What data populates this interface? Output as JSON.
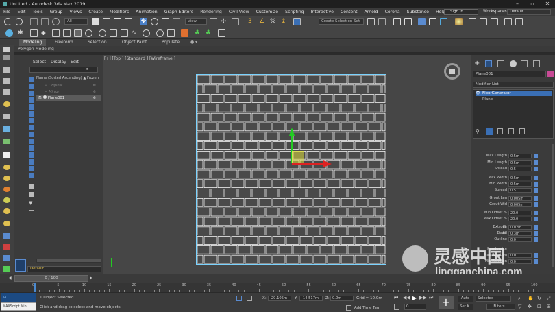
{
  "window": {
    "title": "Untitled - Autodesk 3ds Max 2019"
  },
  "menu": [
    "File",
    "Edit",
    "Tools",
    "Group",
    "Views",
    "Create",
    "Modifiers",
    "Animation",
    "Graph Editors",
    "Rendering",
    "Civil View",
    "Customize",
    "Scripting",
    "Interactive",
    "Content",
    "Arnold",
    "Corona",
    "Substance",
    "Help"
  ],
  "signin": "Sign In",
  "workspaces": {
    "label": "Workspaces:",
    "value": "Default"
  },
  "toolbar": {
    "filter": "All",
    "refcoord": "View",
    "selection_set": "Create Selection Set"
  },
  "ribbon": {
    "tabs": [
      "Modeling",
      "Freeform",
      "Selection",
      "Object Paint",
      "Populate"
    ],
    "sub": "Polygon Modeling"
  },
  "scene_explorer": {
    "tabs": [
      "Select",
      "Display",
      "Edit"
    ],
    "col_name": "Name (Sorted Ascending)",
    "col_frozen": "▲ Frozen",
    "rows": [
      {
        "name": "Original"
      },
      {
        "name": "Mirror"
      },
      {
        "name": "Plane001"
      }
    ],
    "layer": "Default"
  },
  "viewport": {
    "label": "[+] [Top ] [Standard ] [Wireframe ]"
  },
  "command_panel": {
    "object_name": "Plane001",
    "object_color": "#c84a96",
    "modifier_list": "Modifier List",
    "stack": [
      "FloorGenerator",
      "Plane"
    ],
    "params": [
      {
        "label": "Max Length",
        "value": "0.5m"
      },
      {
        "label": "Min Length",
        "value": "0.5m"
      },
      {
        "label": "Spread",
        "value": "0.5"
      },
      {
        "label": "Max Width",
        "value": "0.5m"
      },
      {
        "label": "Min Width",
        "value": "0.5m"
      },
      {
        "label": "Spread",
        "value": "0.5"
      },
      {
        "label": "Grout Len",
        "value": "0.005m"
      },
      {
        "label": "Grout Wid",
        "value": "0.005m"
      },
      {
        "label": "Min Offset %",
        "value": "20.0"
      },
      {
        "label": "Max Offset %",
        "value": "20.0"
      },
      {
        "label": "Extrude",
        "value": "0.02m",
        "prefix": "H"
      },
      {
        "label": "Bevel",
        "value": "0.3m",
        "prefix": "H"
      },
      {
        "label": "Outline",
        "value": "0.0"
      },
      {
        "label": "Randomize",
        "value": ""
      },
      {
        "label": "Max Rotation",
        "value": "0.0"
      },
      {
        "label": "Min Rotation",
        "value": "0.0"
      }
    ]
  },
  "timeline": {
    "frame": "0 / 100",
    "ticks": [
      "0",
      "5",
      "10",
      "15",
      "20",
      "25",
      "30",
      "35",
      "40",
      "45",
      "50",
      "55",
      "60",
      "65",
      "70",
      "75",
      "80",
      "85",
      "90",
      "95",
      "100"
    ]
  },
  "status": {
    "maxscript": "MAXScript Mini",
    "selected": "1 Object Selected",
    "hint": "Click and drag to select and move objects",
    "x": "-29.105m",
    "y": "-14.517m",
    "z": "0.0m",
    "grid": "Grid = 10.0m",
    "add_time_tag": "Add Time Tag",
    "auto": "Auto",
    "selected_dd": "Selected",
    "setk": "Set K.",
    "filters": "Filters...",
    "frame_field": "0"
  },
  "watermark": {
    "cn": "灵感中国",
    "url": "lingganchina.com"
  }
}
